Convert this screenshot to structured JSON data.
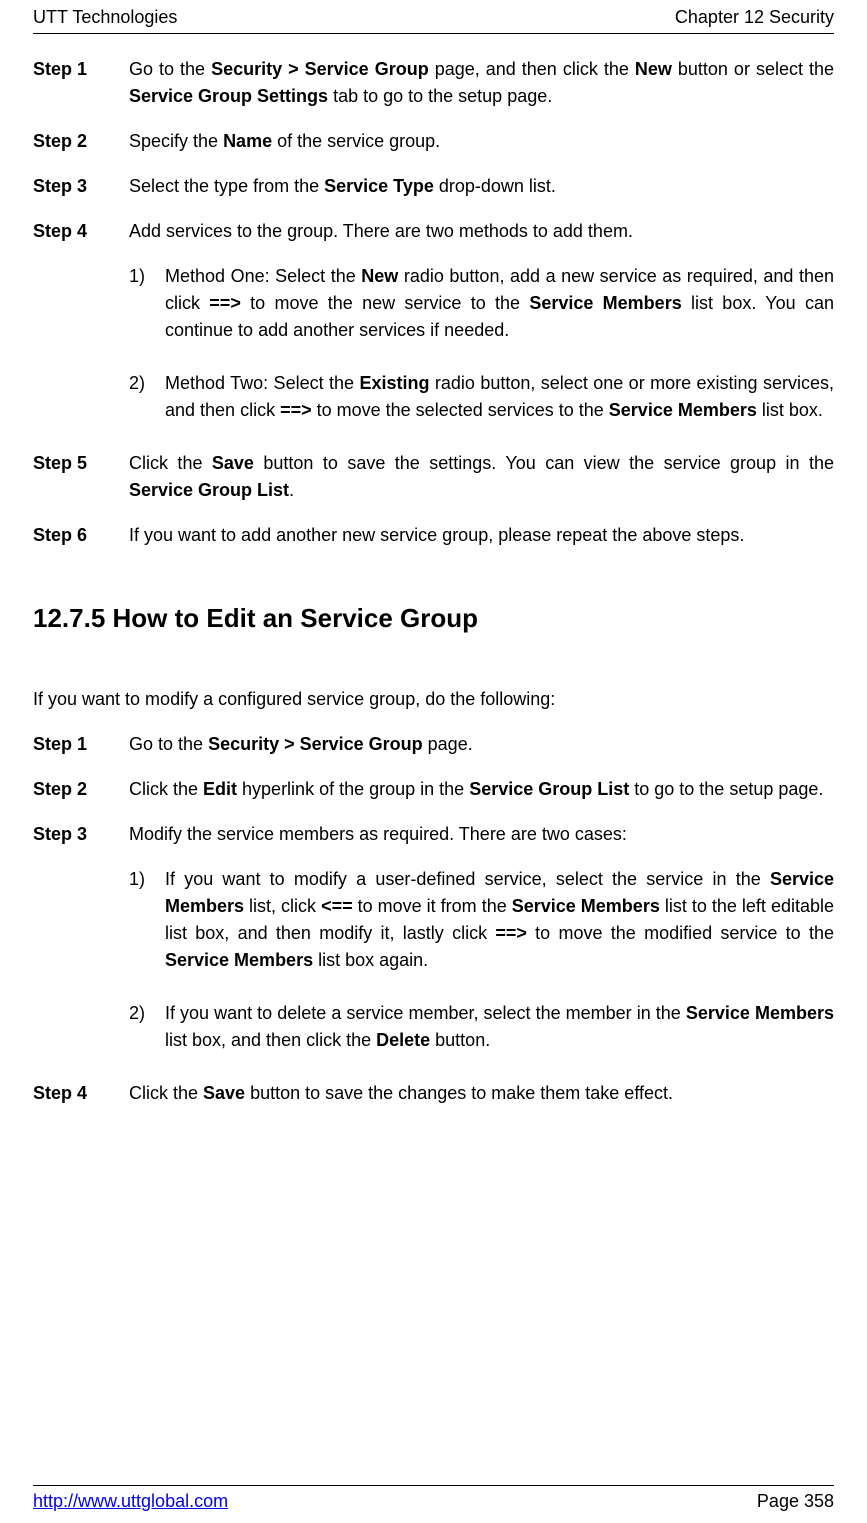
{
  "header": {
    "left": "UTT Technologies",
    "right": "Chapter 12 Security"
  },
  "section1": {
    "steps": [
      {
        "label": "Step 1",
        "runs": [
          {
            "t": "Go to the "
          },
          {
            "t": "Security > Service Group",
            "b": true
          },
          {
            "t": " page, and then click the "
          },
          {
            "t": "New",
            "b": true
          },
          {
            "t": " button or select the "
          },
          {
            "t": "Service Group Settings",
            "b": true
          },
          {
            "t": " tab to go to the setup page."
          }
        ]
      },
      {
        "label": "Step 2",
        "runs": [
          {
            "t": "Specify the "
          },
          {
            "t": "Name",
            "b": true
          },
          {
            "t": " of the service group."
          }
        ]
      },
      {
        "label": "Step 3",
        "runs": [
          {
            "t": "Select the type from the "
          },
          {
            "t": "Service Type",
            "b": true
          },
          {
            "t": " drop-down list."
          }
        ]
      },
      {
        "label": "Step 4",
        "runs": [
          {
            "t": "Add services to the group. There are two methods to add them."
          }
        ],
        "subs": [
          {
            "num": "1)",
            "runs": [
              {
                "t": "Method One: Select the "
              },
              {
                "t": "New",
                "b": true
              },
              {
                "t": " radio button, add a new service as required, and then click "
              },
              {
                "t": "==>",
                "b": true
              },
              {
                "t": " to move the new service to the "
              },
              {
                "t": "Service Members",
                "b": true
              },
              {
                "t": " list box. You can continue to add another services if needed."
              }
            ]
          },
          {
            "num": "2)",
            "runs": [
              {
                "t": "Method Two: Select the "
              },
              {
                "t": "Existing",
                "b": true
              },
              {
                "t": " radio button, select one or more existing services, and then click "
              },
              {
                "t": "==>",
                "b": true
              },
              {
                "t": " to move the selected services to the "
              },
              {
                "t": "Service Members",
                "b": true
              },
              {
                "t": " list box."
              }
            ]
          }
        ]
      },
      {
        "label": "Step 5",
        "runs": [
          {
            "t": "Click the "
          },
          {
            "t": "Save",
            "b": true
          },
          {
            "t": " button to save the settings. You can view the service group in the "
          },
          {
            "t": "Service Group List",
            "b": true
          },
          {
            "t": "."
          }
        ]
      },
      {
        "label": "Step 6",
        "runs": [
          {
            "t": "If you want to add another new service group, please repeat the above steps."
          }
        ]
      }
    ]
  },
  "heading": "12.7.5  How to Edit an Service Group",
  "intro": "If you want to modify a configured service group, do the following:",
  "section2": {
    "steps": [
      {
        "label": "Step 1",
        "runs": [
          {
            "t": "Go to the "
          },
          {
            "t": "Security > Service Group",
            "b": true
          },
          {
            "t": " page."
          }
        ]
      },
      {
        "label": "Step 2",
        "runs": [
          {
            "t": "Click the "
          },
          {
            "t": "Edit",
            "b": true
          },
          {
            "t": " hyperlink of the group in the "
          },
          {
            "t": "Service Group List",
            "b": true
          },
          {
            "t": " to go to the setup page."
          }
        ]
      },
      {
        "label": "Step 3",
        "runs": [
          {
            "t": "Modify the service members as required. There are two cases:"
          }
        ],
        "subs": [
          {
            "num": "1)",
            "runs": [
              {
                "t": "If you want to modify a user-defined service, select the service in the "
              },
              {
                "t": "Service Members",
                "b": true
              },
              {
                "t": " list, click "
              },
              {
                "t": "<==",
                "b": true
              },
              {
                "t": " to move it from the "
              },
              {
                "t": "Service Members",
                "b": true
              },
              {
                "t": " list to the left editable list box, and then modify it, lastly click "
              },
              {
                "t": "==>",
                "b": true
              },
              {
                "t": " to move the modified service to the "
              },
              {
                "t": "Service Members",
                "b": true
              },
              {
                "t": " list box again."
              }
            ]
          },
          {
            "num": "2)",
            "runs": [
              {
                "t": "If you want to delete a service member, select the member in the "
              },
              {
                "t": "Service Members",
                "b": true
              },
              {
                "t": " list box, and then click the "
              },
              {
                "t": "Delete",
                "b": true
              },
              {
                "t": " button."
              }
            ]
          }
        ]
      },
      {
        "label": "Step 4",
        "runs": [
          {
            "t": "Click the "
          },
          {
            "t": "Save",
            "b": true
          },
          {
            "t": " button to save the changes to make them take effect."
          }
        ]
      }
    ]
  },
  "footer": {
    "url": "http://www.uttglobal.com",
    "page": "Page 358"
  }
}
